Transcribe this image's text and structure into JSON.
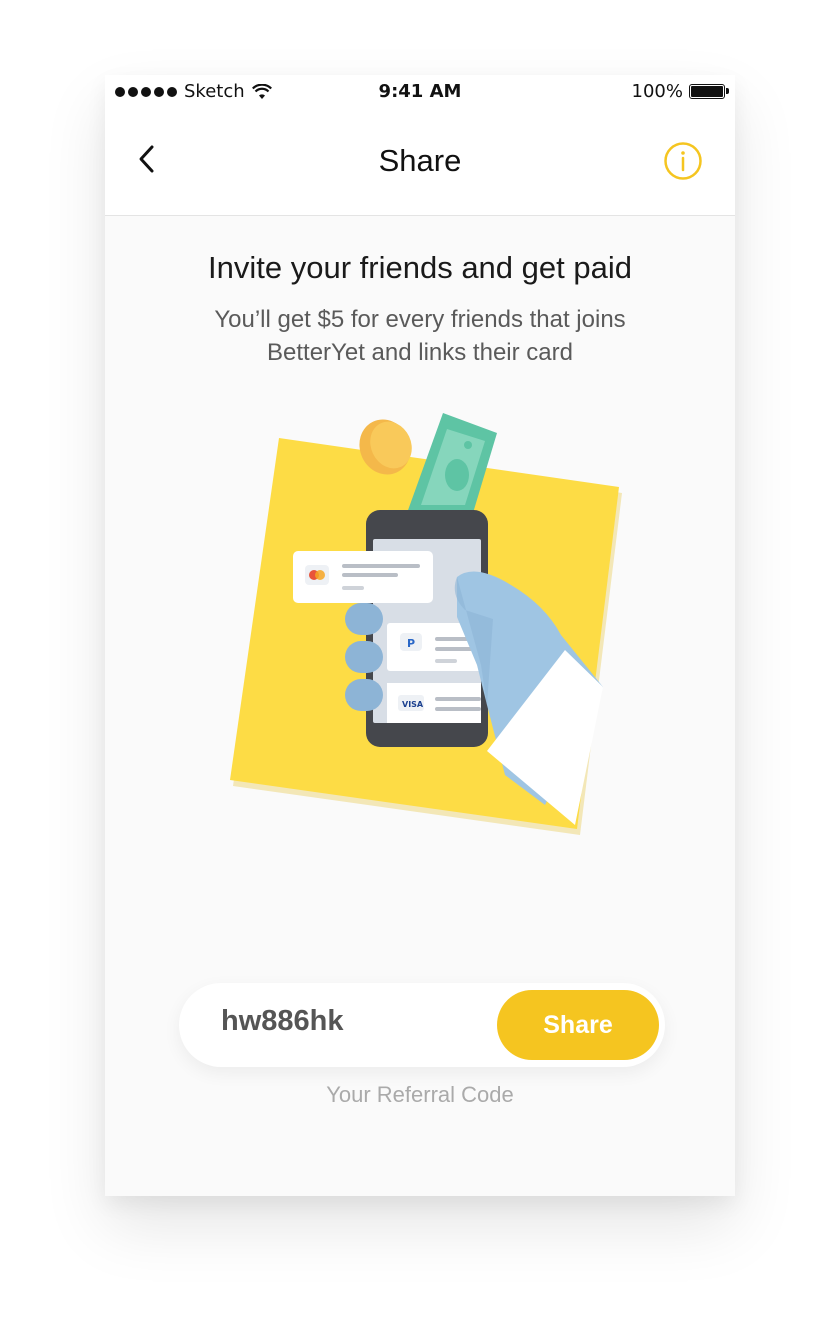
{
  "status_bar": {
    "carrier": "Sketch",
    "time": "9:41 AM",
    "battery": "100%"
  },
  "nav": {
    "title": "Share",
    "back_icon": "chevron-left-icon",
    "info_icon": "info-icon"
  },
  "content": {
    "headline": "Invite your friends and get paid",
    "subline": "You’ll get $5 for every friends that joins BetterYet and links their card"
  },
  "illustration": {
    "visa_label": "VISA"
  },
  "referral": {
    "code": "hw886hk",
    "share_label": "Share",
    "caption": "Your Referral Code"
  },
  "colors": {
    "accent": "#f5c520",
    "illustration_yellow": "#fddc45",
    "money_green": "#5ec4a4",
    "hand_blue": "#9fc5e3"
  }
}
